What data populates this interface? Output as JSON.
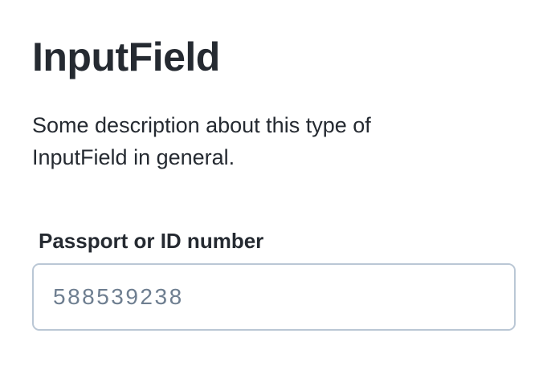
{
  "header": {
    "title": "InputField",
    "description": "Some description about this type of InputField in general."
  },
  "field": {
    "label": "Passport or ID number",
    "value": "",
    "placeholder": "588539238"
  },
  "colors": {
    "text": "#252a31",
    "placeholder": "#6e7e90",
    "border": "#bac7d5",
    "background": "#ffffff"
  }
}
